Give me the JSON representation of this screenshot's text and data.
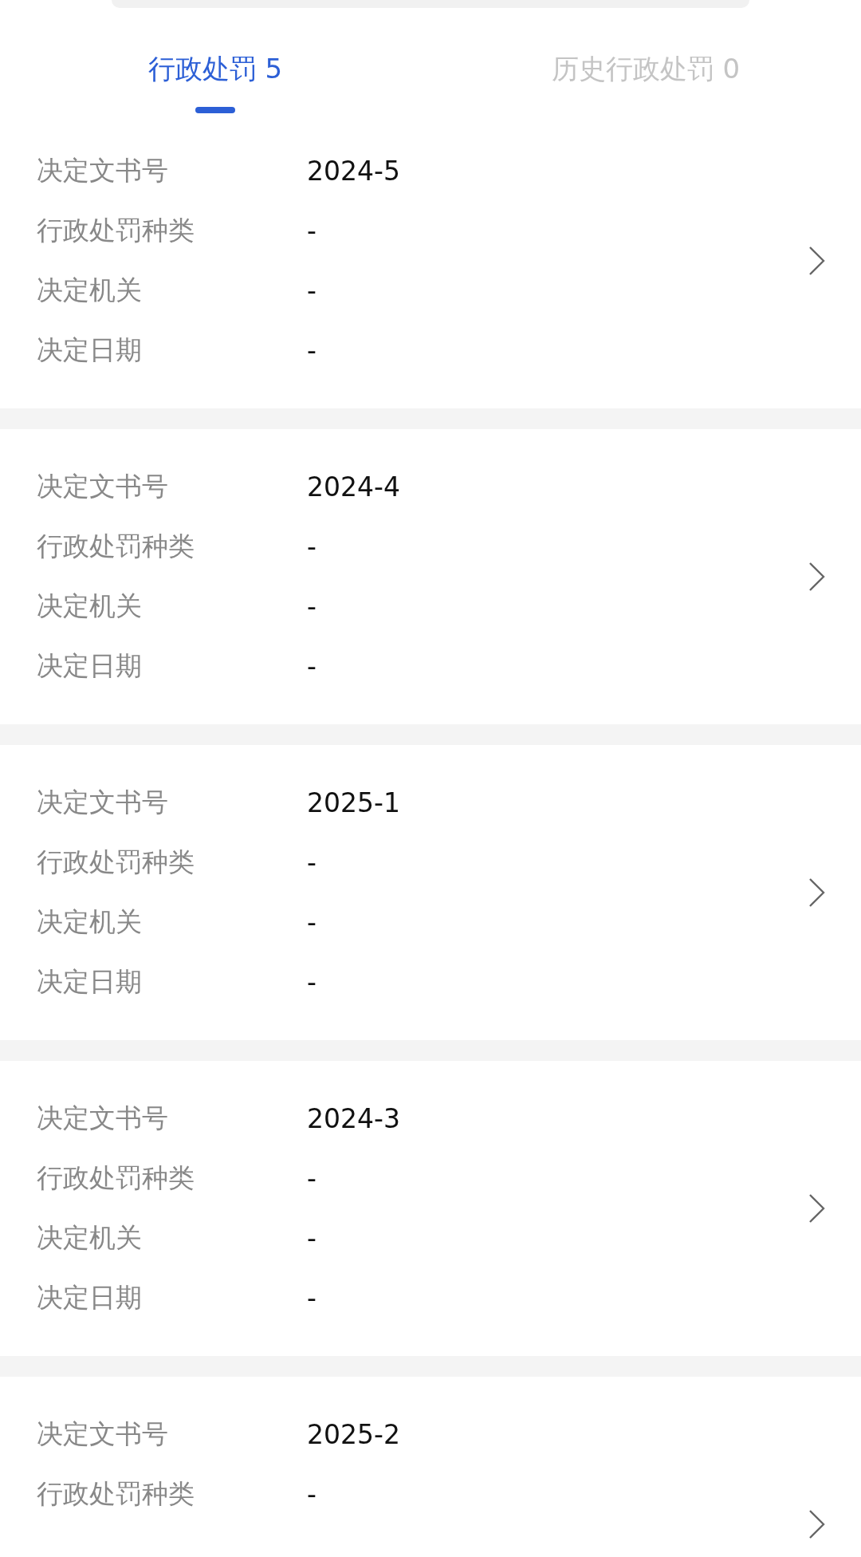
{
  "tabs": [
    {
      "label": "行政处罚 5",
      "selected": true
    },
    {
      "label": "历史行政处罚 0",
      "selected": false
    }
  ],
  "records": [
    {
      "fields": [
        {
          "label": "决定文书号",
          "value": "2024-5"
        },
        {
          "label": "行政处罚种类",
          "value": "-"
        },
        {
          "label": "决定机关",
          "value": "-"
        },
        {
          "label": "决定日期",
          "value": "-"
        }
      ]
    },
    {
      "fields": [
        {
          "label": "决定文书号",
          "value": "2024-4"
        },
        {
          "label": "行政处罚种类",
          "value": "-"
        },
        {
          "label": "决定机关",
          "value": "-"
        },
        {
          "label": "决定日期",
          "value": "-"
        }
      ]
    },
    {
      "fields": [
        {
          "label": "决定文书号",
          "value": "2025-1"
        },
        {
          "label": "行政处罚种类",
          "value": "-"
        },
        {
          "label": "决定机关",
          "value": "-"
        },
        {
          "label": "决定日期",
          "value": "-"
        }
      ]
    },
    {
      "fields": [
        {
          "label": "决定文书号",
          "value": "2024-3"
        },
        {
          "label": "行政处罚种类",
          "value": "-"
        },
        {
          "label": "决定机关",
          "value": "-"
        },
        {
          "label": "决定日期",
          "value": "-"
        }
      ]
    },
    {
      "fields": [
        {
          "label": "决定文书号",
          "value": "2025-2"
        },
        {
          "label": "行政处罚种类",
          "value": "-"
        }
      ]
    }
  ]
}
